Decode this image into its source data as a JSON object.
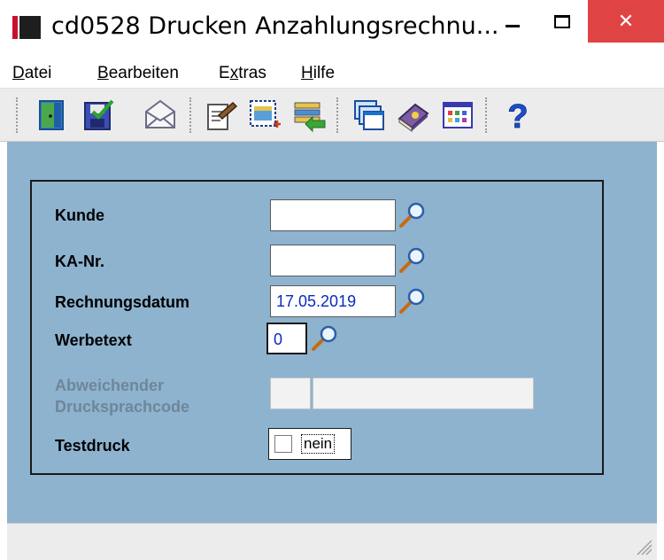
{
  "window": {
    "title": "cd0528 Drucken Anzahlungsrechnu...",
    "close_glyph": "✕"
  },
  "menu": {
    "items": [
      {
        "label": "Datei",
        "accel": "D",
        "rest": "atei"
      },
      {
        "label": "Bearbeiten",
        "accel": "B",
        "rest": "earbeiten"
      },
      {
        "label": "Extras",
        "accel": "x",
        "pre": "E",
        "rest": "tras"
      },
      {
        "label": "Hilfe",
        "accel": "H",
        "rest": "ilfe"
      }
    ]
  },
  "toolbar": {
    "icons": [
      "exit-door-icon",
      "save-icon",
      "mail-envelope-icon",
      "print-document-icon",
      "new-record-icon",
      "list-transfer-icon",
      "windows-icon",
      "book-icon",
      "grid-table-icon",
      "help-question-icon"
    ]
  },
  "form": {
    "customer_label": "Kunde",
    "customer_value": "",
    "ka_label": "KA-Nr.",
    "ka_value": "",
    "invoice_date_label": "Rechnungsdatum",
    "invoice_date_value": "17.05.2019",
    "ad_text_label": "Werbetext",
    "ad_text_value": "0",
    "print_lang_label_1": "Abweichender",
    "print_lang_label_2": "Drucksprachcode",
    "print_lang_code": "",
    "print_lang_desc": "",
    "test_print_label": "Testdruck",
    "test_print_checked": false,
    "test_print_value": "nein"
  },
  "colors": {
    "client_bg": "#8db3cf",
    "input_text": "#0b2bbd",
    "close_button": "#e04343",
    "disabled_label": "#6f8698"
  },
  "status": {
    "text": ""
  }
}
